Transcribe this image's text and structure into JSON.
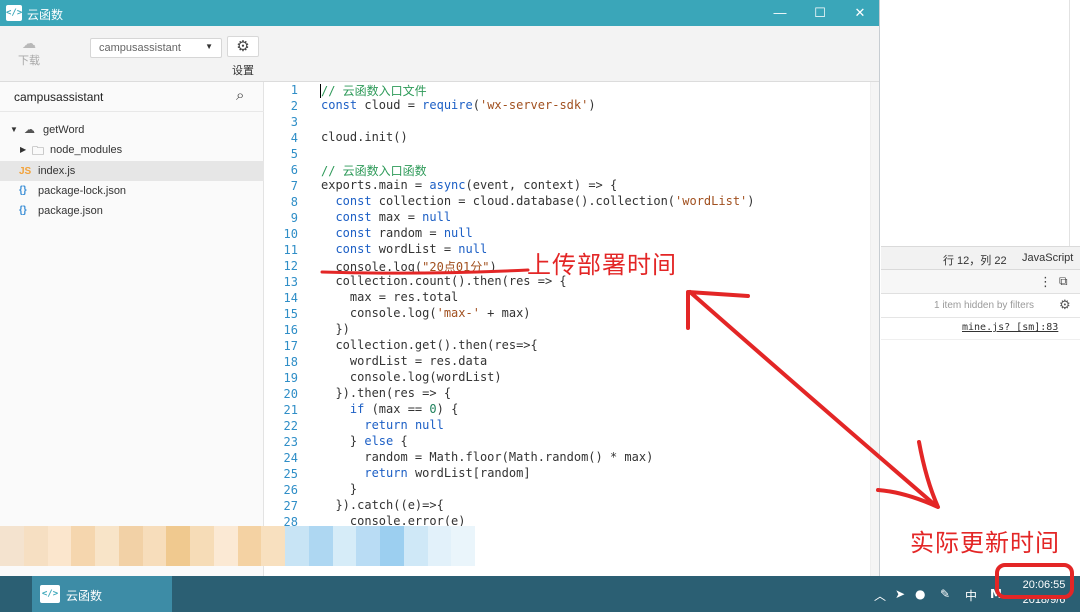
{
  "window": {
    "title": "云函数",
    "app_icon": "</>",
    "controls": {
      "minimize": "—",
      "maximize": "☐",
      "close": "✕"
    }
  },
  "toolbar": {
    "download_label": "下载",
    "env_selected": "campusassistant",
    "settings_label": "设置"
  },
  "sidebar": {
    "project": "campusassistant",
    "tree": [
      {
        "label": "getWord",
        "kind": "cloud-folder",
        "expanded": true
      },
      {
        "label": "node_modules",
        "kind": "folder",
        "expanded": false
      },
      {
        "label": "index.js",
        "kind": "js",
        "selected": true
      },
      {
        "label": "package-lock.json",
        "kind": "json"
      },
      {
        "label": "package.json",
        "kind": "json"
      }
    ]
  },
  "editor": {
    "line_numbers": [
      "1",
      "2",
      "3",
      "4",
      "5",
      "6",
      "7",
      "8",
      "9",
      "10",
      "11",
      "12",
      "13",
      "14",
      "15",
      "16",
      "17",
      "18",
      "19",
      "20",
      "21",
      "22",
      "23",
      "24",
      "25",
      "26",
      "27",
      "28"
    ]
  },
  "right_panel": {
    "cursor_position": "行 12，列 22",
    "language": "JavaScript",
    "filter_note": "1 item hidden by filters",
    "log_source": "mine.js? [sm]:83"
  },
  "taskbar": {
    "task_label": "云函数",
    "ime": "中",
    "clock_time": "20:06:55",
    "clock_date": "2018/9/6"
  },
  "annotations": {
    "deploy_time": "上传部署时间",
    "actual_update_time": "实际更新时间"
  },
  "colors": {
    "titlebar": "#3aa6b9",
    "taskbar": "#2b5f73",
    "annotation": "#e32626"
  }
}
